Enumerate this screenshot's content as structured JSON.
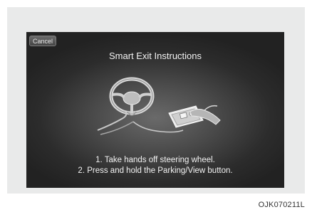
{
  "screen": {
    "cancel_label": "Cancel",
    "title": "Smart Exit Instructions",
    "steps": [
      "1. Take hands off steering wheel.",
      "2. Press and hold the Parking/View button."
    ],
    "illustration": {
      "icons": [
        "steering-wheel-icon",
        "parking-view-button-icon"
      ]
    }
  },
  "figure_code": "OJK070211L",
  "colors": {
    "frame_background": "#e9eaea",
    "screen_dark": "#222222",
    "text": "#f2f2f2"
  }
}
